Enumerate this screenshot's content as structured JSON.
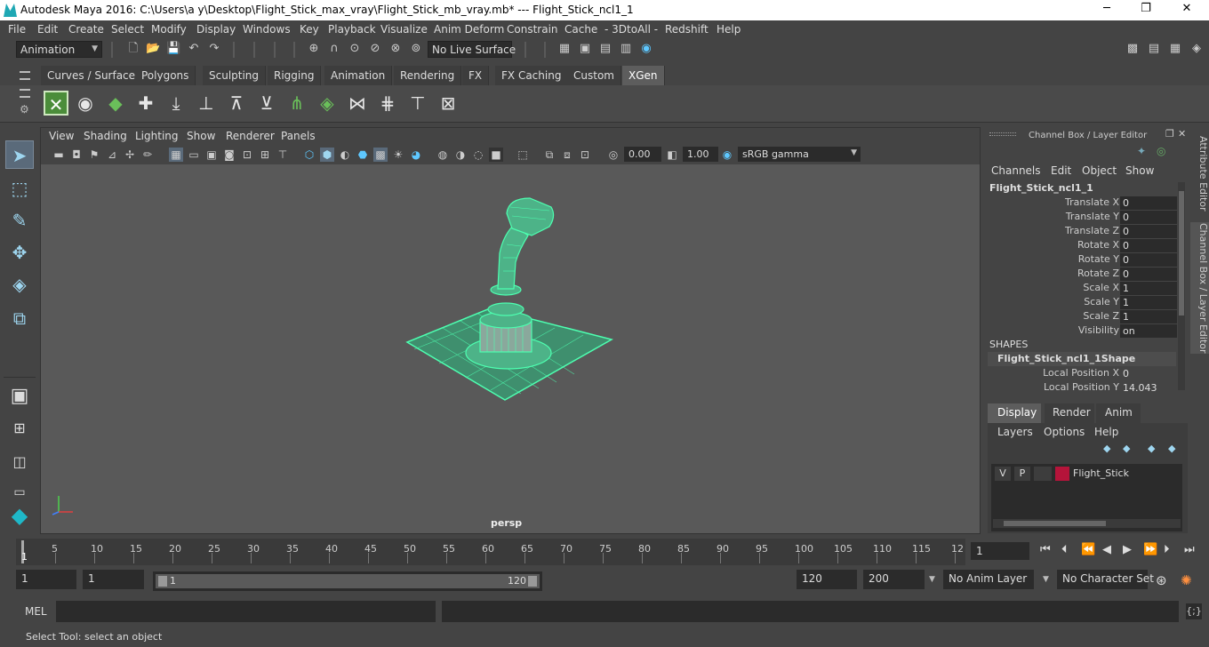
{
  "window": {
    "title": "Autodesk Maya 2016: C:\\Users\\a y\\Desktop\\Flight_Stick_max_vray\\Flight_Stick_mb_vray.mb*   ---   Flight_Stick_ncl1_1",
    "minimize": "─",
    "maximize": "❐",
    "close": "✕"
  },
  "menubar": [
    "File",
    "Edit",
    "Create",
    "Select",
    "Modify",
    "Display",
    "Windows",
    "Key",
    "Playback",
    "Visualize",
    "Anim Deform",
    "Constrain",
    "Cache",
    "- 3DtoAll -",
    "Redshift",
    "Help"
  ],
  "toolbar": {
    "mode": "Animation",
    "live_surface": "No Live Surface"
  },
  "shelf_tabs": [
    "Curves / Surfaces",
    "Polygons",
    "Sculpting",
    "Rigging",
    "Animation",
    "Rendering",
    "FX",
    "FX Caching",
    "Custom",
    "XGen"
  ],
  "active_shelf_tab": "XGen",
  "viewport": {
    "menu": [
      "View",
      "Shading",
      "Lighting",
      "Show",
      "Renderer",
      "Panels"
    ],
    "exposure": "0.00",
    "gamma": "1.00",
    "colorspace": "sRGB gamma",
    "camera": "persp"
  },
  "channel_box": {
    "header": "Channel Box / Layer Editor",
    "menu": [
      "Channels",
      "Edit",
      "Object",
      "Show"
    ],
    "object": "Flight_Stick_ncl1_1",
    "attributes": [
      {
        "label": "Translate X",
        "value": "0"
      },
      {
        "label": "Translate Y",
        "value": "0"
      },
      {
        "label": "Translate Z",
        "value": "0"
      },
      {
        "label": "Rotate X",
        "value": "0"
      },
      {
        "label": "Rotate Y",
        "value": "0"
      },
      {
        "label": "Rotate Z",
        "value": "0"
      },
      {
        "label": "Scale X",
        "value": "1"
      },
      {
        "label": "Scale Y",
        "value": "1"
      },
      {
        "label": "Scale Z",
        "value": "1"
      },
      {
        "label": "Visibility",
        "value": "on"
      }
    ],
    "shapes_label": "SHAPES",
    "shape_name": "Flight_Stick_ncl1_1Shape",
    "shape_attrs": [
      {
        "label": "Local Position X",
        "value": "0"
      },
      {
        "label": "Local Position Y",
        "value": "14.043"
      }
    ]
  },
  "layer_editor": {
    "tabs": [
      "Display",
      "Render",
      "Anim"
    ],
    "active_tab": "Display",
    "menu": [
      "Layers",
      "Options",
      "Help"
    ],
    "layer": {
      "v": "V",
      "p": "P",
      "name": "Flight_Stick",
      "color": "#b5143a"
    }
  },
  "side_tabs": [
    "Attribute Editor",
    "Channel Box / Layer Editor"
  ],
  "timeline": {
    "ticks": [
      "5",
      "10",
      "15",
      "20",
      "25",
      "30",
      "35",
      "40",
      "45",
      "50",
      "55",
      "60",
      "65",
      "70",
      "75",
      "80",
      "85",
      "90",
      "95",
      "100",
      "105",
      "110",
      "115",
      "12"
    ],
    "start_marker": "1",
    "current_frame": "1"
  },
  "range": {
    "start": "1",
    "range_start": "1",
    "slider_start": "1",
    "slider_end": "120",
    "range_end": "120",
    "end": "200",
    "anim_layer": "No Anim Layer",
    "char_set": "No Character Set"
  },
  "mel": {
    "label": "MEL"
  },
  "status": "Select Tool: select an object",
  "colors": {
    "wireframe": "#4dffb0",
    "accent": "#5d5d5d"
  }
}
